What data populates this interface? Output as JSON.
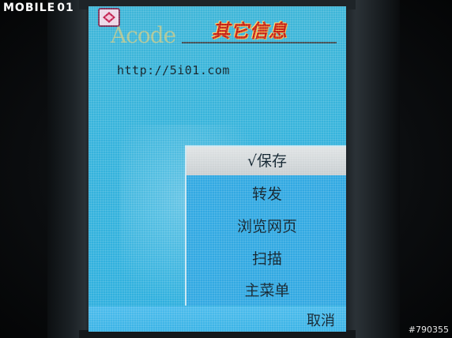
{
  "watermark": {
    "brand": "MOBILE",
    "brand_mark": "01"
  },
  "screen": {
    "logo": "Acode",
    "title": "其它信息",
    "url": "http://5i01.com"
  },
  "menu": {
    "items": [
      {
        "label": "√保存",
        "selected": true
      },
      {
        "label": "转发",
        "selected": false
      },
      {
        "label": "浏览网页",
        "selected": false
      },
      {
        "label": "扫描",
        "selected": false
      },
      {
        "label": "主菜单",
        "selected": false
      }
    ]
  },
  "softkeys": {
    "right": "取消"
  },
  "photo_id": "#790355",
  "colors": {
    "screen_bg": "#36b3dc",
    "menu_bg": "#32a9e2",
    "menu_selected_bg": "#d6dadc",
    "title_red": "#c41e12"
  }
}
